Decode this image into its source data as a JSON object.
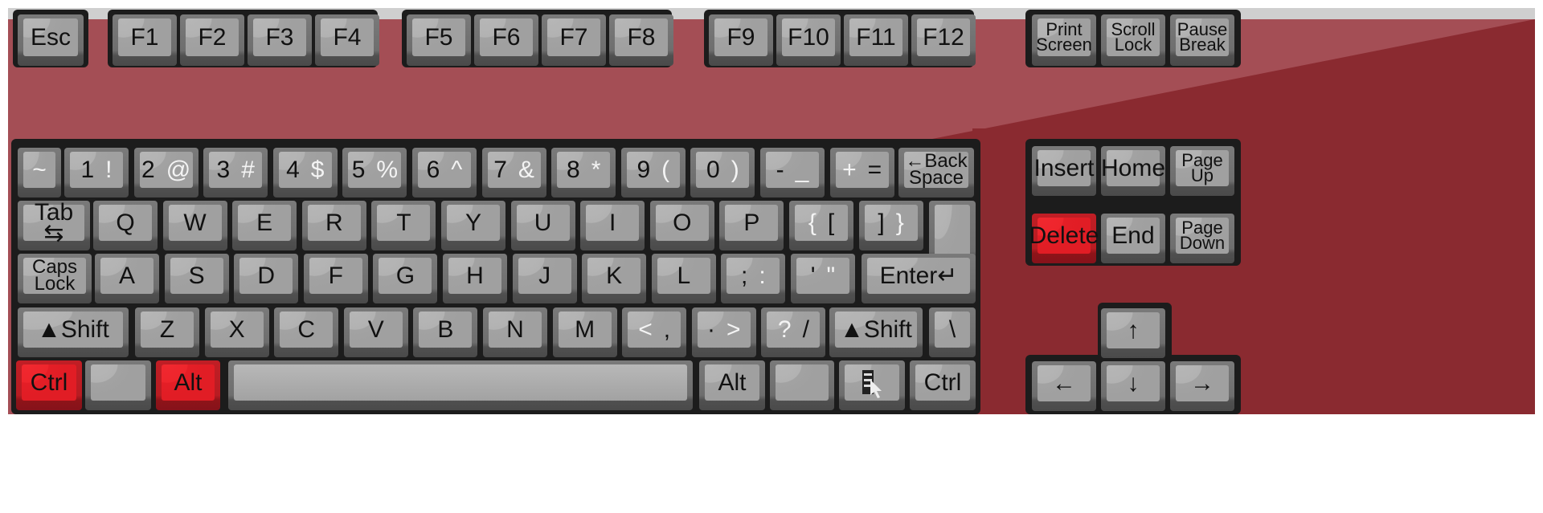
{
  "colors": {
    "body": "#a44e55",
    "body_dark": "#8a2a30",
    "key_face": "#a4a4a4",
    "key_red": "#e8202a",
    "frame": "#1c1c1c"
  },
  "function_row": [
    {
      "main": "Esc"
    },
    {
      "main": "F1"
    },
    {
      "main": "F2"
    },
    {
      "main": "F3"
    },
    {
      "main": "F4"
    },
    {
      "main": "F5"
    },
    {
      "main": "F6"
    },
    {
      "main": "F7"
    },
    {
      "main": "F8"
    },
    {
      "main": "F9"
    },
    {
      "main": "F10"
    },
    {
      "main": "F11"
    },
    {
      "main": "F12"
    },
    {
      "main": "Print\nScreen"
    },
    {
      "main": "Scroll\nLock"
    },
    {
      "main": "Pause\nBreak"
    }
  ],
  "row1": [
    {
      "alt": "~"
    },
    {
      "main": "1",
      "alt": "!"
    },
    {
      "main": "2",
      "alt": "@"
    },
    {
      "main": "3",
      "alt": "#"
    },
    {
      "main": "4",
      "alt": "$"
    },
    {
      "main": "5",
      "alt": "%"
    },
    {
      "main": "6",
      "alt": "^"
    },
    {
      "main": "7",
      "alt": "&"
    },
    {
      "main": "8",
      "alt": "*"
    },
    {
      "main": "9",
      "alt": "("
    },
    {
      "main": "0",
      "alt": ")"
    },
    {
      "alt": "_",
      "main": "-"
    },
    {
      "alt": "+",
      "main": "="
    },
    {
      "main": "←Back\nSpace"
    }
  ],
  "row2": [
    {
      "main": "Tab ⇆"
    },
    {
      "main": "Q"
    },
    {
      "main": "W"
    },
    {
      "main": "E"
    },
    {
      "main": "R"
    },
    {
      "main": "T"
    },
    {
      "main": "Y"
    },
    {
      "main": "U"
    },
    {
      "main": "I"
    },
    {
      "main": "O"
    },
    {
      "main": "P"
    },
    {
      "alt": "{",
      "main": "["
    },
    {
      "main": "]",
      "alt": "}"
    }
  ],
  "row3": [
    {
      "main": "Caps\nLock"
    },
    {
      "main": "A"
    },
    {
      "main": "S"
    },
    {
      "main": "D"
    },
    {
      "main": "F"
    },
    {
      "main": "G"
    },
    {
      "main": "H"
    },
    {
      "main": "J"
    },
    {
      "main": "K"
    },
    {
      "main": "L"
    },
    {
      "main": ";",
      "alt": ":"
    },
    {
      "main": "'",
      "alt": "\""
    },
    {
      "main": "Enter↵"
    }
  ],
  "row4": [
    {
      "main": "▲Shift"
    },
    {
      "main": "Z"
    },
    {
      "main": "X"
    },
    {
      "main": "C"
    },
    {
      "main": "V"
    },
    {
      "main": "B"
    },
    {
      "main": "N"
    },
    {
      "main": "M"
    },
    {
      "alt": "<",
      "main": ","
    },
    {
      "main": "·",
      "alt": ">"
    },
    {
      "alt": "?",
      "main": "/"
    },
    {
      "main": "▲Shift"
    },
    {
      "main": "\\"
    }
  ],
  "row5": [
    {
      "main": "Ctrl",
      "color": "red"
    },
    {
      "main": ""
    },
    {
      "main": "Alt",
      "color": "red"
    },
    {
      "main": "",
      "icon": "spacebar"
    },
    {
      "main": "Alt"
    },
    {
      "main": ""
    },
    {
      "main": "",
      "icon": "menu-icon"
    },
    {
      "main": "Ctrl"
    }
  ],
  "nav": [
    {
      "main": "Insert"
    },
    {
      "main": "Home"
    },
    {
      "main": "Page\nUp"
    },
    {
      "main": "Delete",
      "color": "red"
    },
    {
      "main": "End"
    },
    {
      "main": "Page\nDown"
    }
  ],
  "arrows": [
    {
      "main": "↑",
      "icon": "arrow-up-icon"
    },
    {
      "main": "←",
      "icon": "arrow-left-icon"
    },
    {
      "main": "↓",
      "icon": "arrow-down-icon"
    },
    {
      "main": "→",
      "icon": "arrow-right-icon"
    }
  ]
}
